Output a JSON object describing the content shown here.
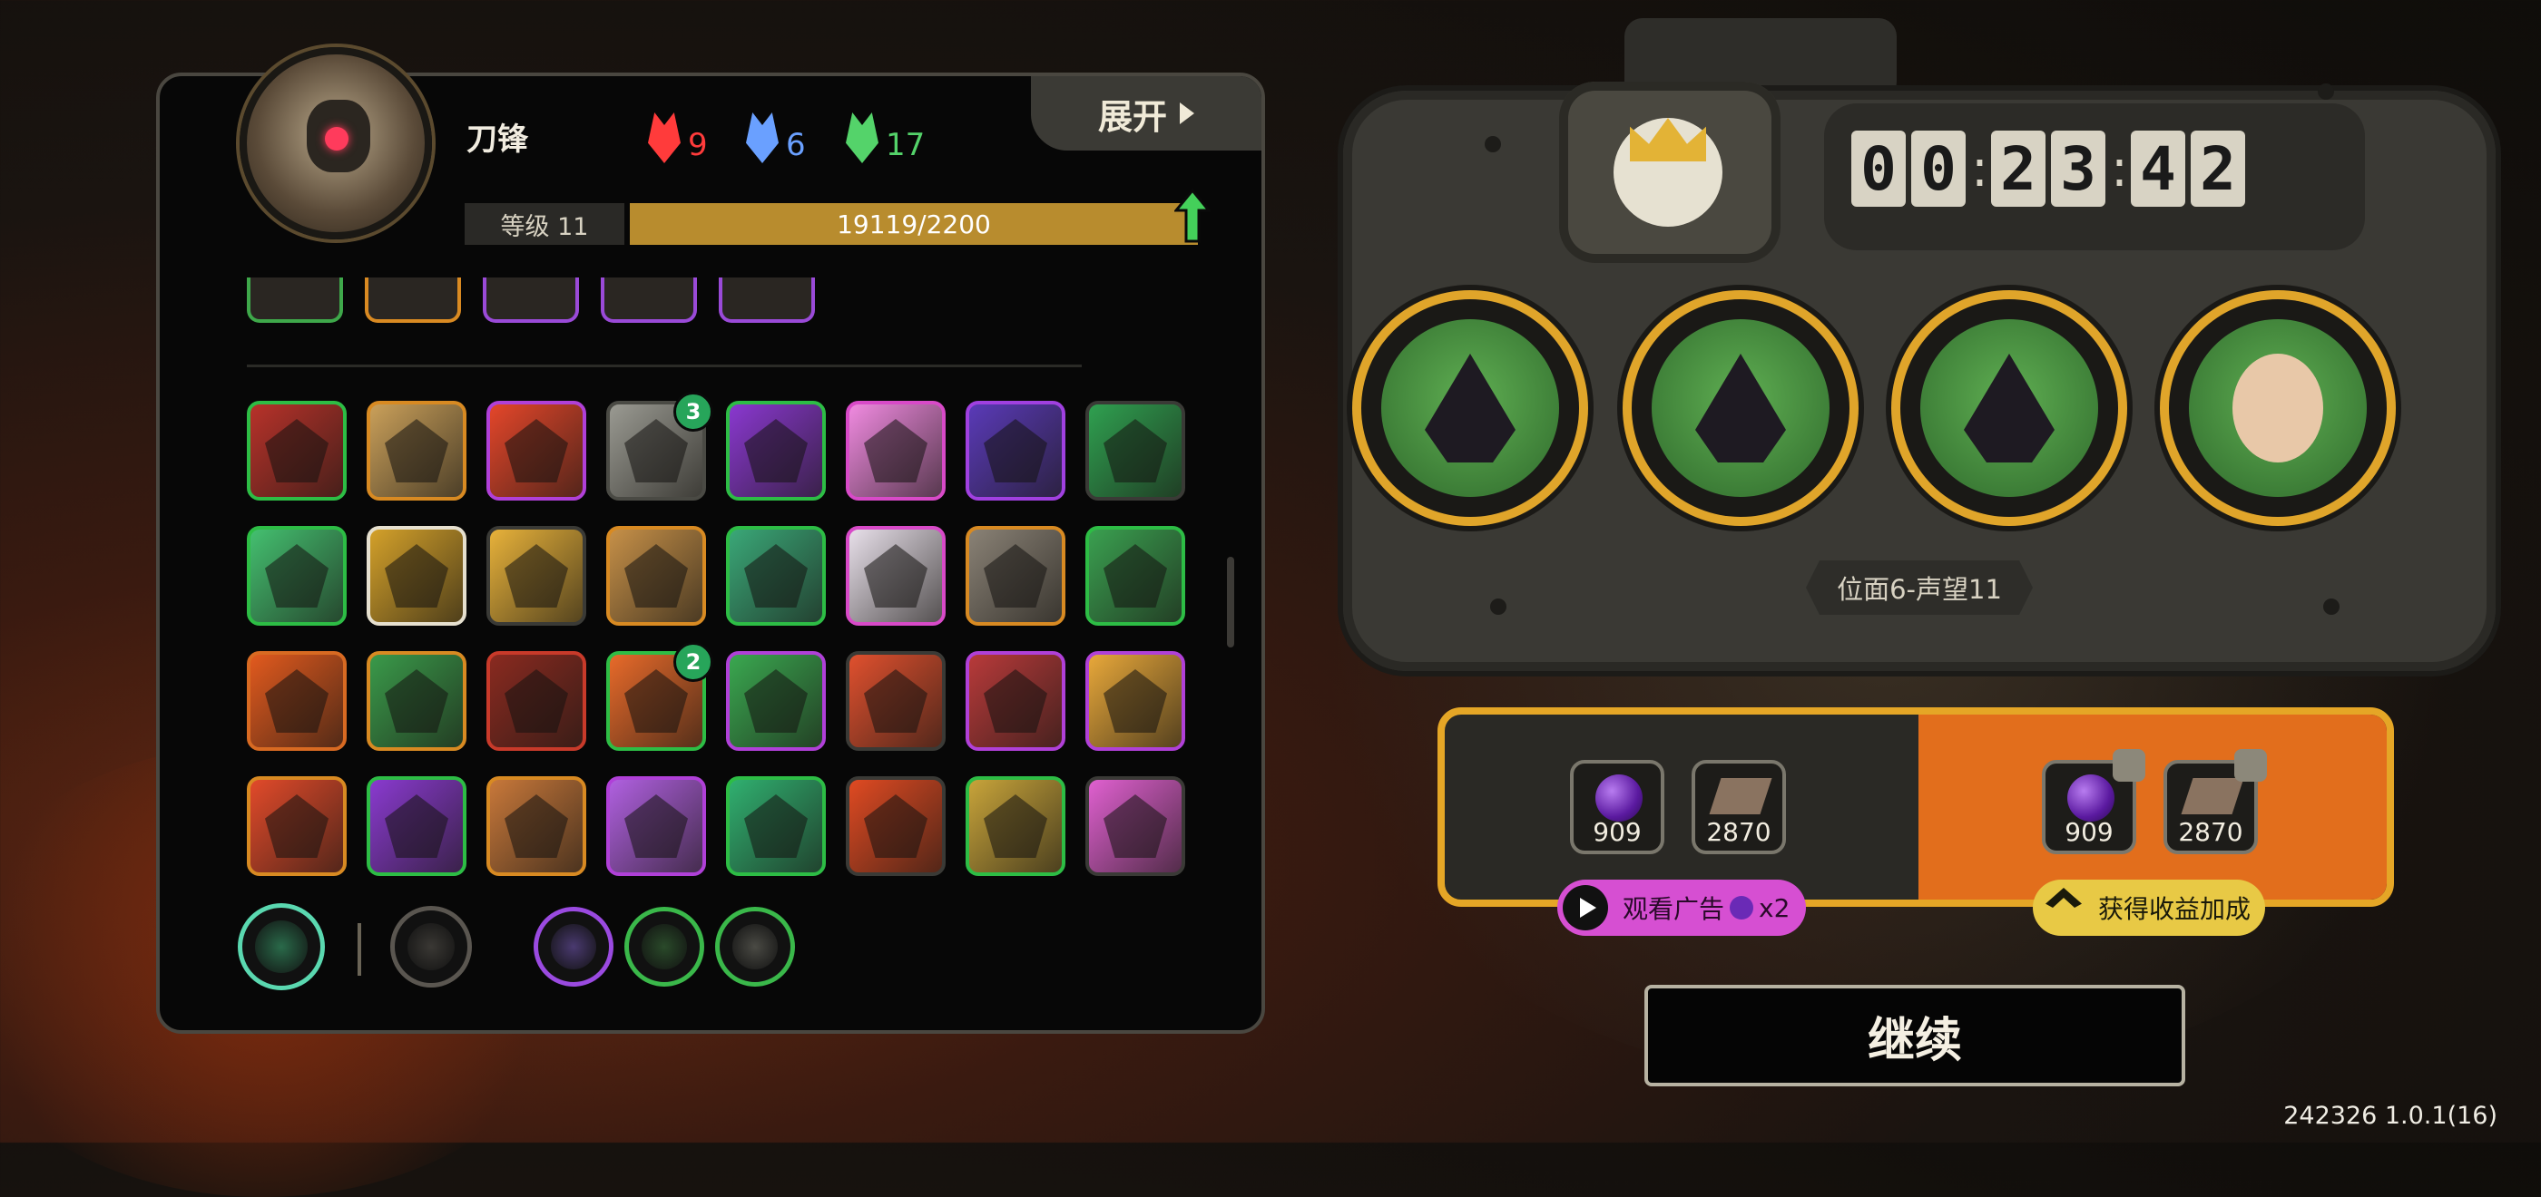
{
  "hero": {
    "name": "刀锋",
    "level_label": "等级 11",
    "xp_text": "19119/2200",
    "xp_fraction": 1.0
  },
  "resources": [
    {
      "icon": "red-mask-icon",
      "value": "9",
      "color": "#ff3b3b"
    },
    {
      "icon": "blue-mask-icon",
      "value": "6",
      "color": "#6aa0ff"
    },
    {
      "icon": "green-mask-icon",
      "value": "17",
      "color": "#54d36a"
    }
  ],
  "expand_button": {
    "label": "展开"
  },
  "partial_row": [
    {
      "icon": "partial-skill-icon",
      "color": "#3ea84a"
    },
    {
      "icon": "partial-skill-icon",
      "color": "#d98a22"
    },
    {
      "icon": "partial-skill-icon",
      "color": "#9a4ad8"
    },
    {
      "icon": "partial-skill-icon",
      "color": "#9a4ad8"
    },
    {
      "icon": "partial-skill-icon",
      "color": "#9a4ad8"
    }
  ],
  "skills": [
    {
      "icon": "dragon-head-icon",
      "border": "#2dbd45",
      "fill": "#b8322a",
      "badge": ""
    },
    {
      "icon": "gear-eye-icon",
      "border": "#d88a22",
      "fill": "#caa05a",
      "badge": ""
    },
    {
      "icon": "lightning-icon",
      "border": "#b040d8",
      "fill": "#e4462a",
      "badge": ""
    },
    {
      "icon": "armored-box-icon",
      "border": "#4a4a44",
      "fill": "#9a9a92",
      "badge": "3"
    },
    {
      "icon": "warning-triangle-icon",
      "border": "#2dbd45",
      "fill": "#8a38d0",
      "badge": ""
    },
    {
      "icon": "pink-burst-icon",
      "border": "#d84ac8",
      "fill": "#f08ae0",
      "badge": ""
    },
    {
      "icon": "crystal-icon",
      "border": "#a040e0",
      "fill": "#5a3ab8",
      "badge": ""
    },
    {
      "icon": "green-claws-icon",
      "border": "#3a3a36",
      "fill": "#2fa050",
      "badge": ""
    },
    {
      "icon": "green-diamond-icon",
      "border": "#2dbd45",
      "fill": "#44c070",
      "badge": ""
    },
    {
      "icon": "golden-helm-icon",
      "border": "#e6e0cf",
      "fill": "#d4a12a",
      "badge": ""
    },
    {
      "icon": "explosion-icon",
      "border": "#3a3a36",
      "fill": "#e8b23a",
      "badge": ""
    },
    {
      "icon": "spike-icon",
      "border": "#d88a22",
      "fill": "#c69048",
      "badge": ""
    },
    {
      "icon": "arrows-icon",
      "border": "#2dbd45",
      "fill": "#3aa878",
      "badge": ""
    },
    {
      "icon": "mask-face-icon",
      "border": "#d84ac8",
      "fill": "#e8e0ea",
      "badge": ""
    },
    {
      "icon": "round-shield-icon",
      "border": "#d88a22",
      "fill": "#8a8276",
      "badge": ""
    },
    {
      "icon": "red-cursor-icon",
      "border": "#2dbd45",
      "fill": "#3aa050",
      "badge": ""
    },
    {
      "icon": "flame-face-icon",
      "border": "#d86a22",
      "fill": "#e25a1e",
      "badge": ""
    },
    {
      "icon": "green-tooth-icon",
      "border": "#d88a22",
      "fill": "#3a9a4a",
      "badge": ""
    },
    {
      "icon": "red-rings-icon",
      "border": "#c83a2a",
      "fill": "#8a2a20",
      "badge": ""
    },
    {
      "icon": "wings-icon",
      "border": "#2dbd45",
      "fill": "#e86a2a",
      "badge": "2"
    },
    {
      "icon": "green-slash-icon",
      "border": "#b040d8",
      "fill": "#3aa850",
      "badge": ""
    },
    {
      "icon": "pointing-hand-icon",
      "border": "#3a3a36",
      "fill": "#e0502e",
      "badge": ""
    },
    {
      "icon": "red-pod-icon",
      "border": "#b040d8",
      "fill": "#b83a3a",
      "badge": ""
    },
    {
      "icon": "bell-icon",
      "border": "#b040d8",
      "fill": "#e8a83a",
      "badge": ""
    },
    {
      "icon": "red-flower-icon",
      "border": "#d88a22",
      "fill": "#e24a2a",
      "badge": ""
    },
    {
      "icon": "purple-claws-icon",
      "border": "#2dbd45",
      "fill": "#8a3ad0",
      "badge": ""
    },
    {
      "icon": "wood-slash-icon",
      "border": "#d88a22",
      "fill": "#c8783a",
      "badge": ""
    },
    {
      "icon": "purple-drip-icon",
      "border": "#b040d8",
      "fill": "#b060e0",
      "badge": ""
    },
    {
      "icon": "green-shards-icon",
      "border": "#2dbd45",
      "fill": "#30b070",
      "badge": ""
    },
    {
      "icon": "fire-icon",
      "border": "#3a3a36",
      "fill": "#e04a22",
      "badge": ""
    },
    {
      "icon": "coin-shield-icon",
      "border": "#2dbd45",
      "fill": "#c8a43a",
      "badge": ""
    },
    {
      "icon": "pink-flame-icon",
      "border": "#3a3a36",
      "fill": "#e060d0",
      "badge": ""
    }
  ],
  "equipped_main": [
    {
      "icon": "green-wind-icon",
      "ring": "#5ad8b0",
      "fill": "#2a6a4a"
    },
    {
      "icon": "feather-knife-icon",
      "ring": "#5a5650",
      "fill": "#3a3834"
    }
  ],
  "equipped_items": [
    {
      "icon": "gold-insignia-icon",
      "ring": "#9a4ae0",
      "fill": "#4a3a70"
    },
    {
      "icon": "green-flask-icon",
      "ring": "#3ab84a",
      "fill": "#2a4a2a"
    },
    {
      "icon": "silver-triangle-icon",
      "ring": "#3ab84a",
      "fill": "#4a4a44"
    }
  ],
  "timer": {
    "digits": [
      "0",
      "0",
      "2",
      "3",
      "4",
      "2"
    ]
  },
  "party": [
    {
      "icon": "hooded-figure-icon",
      "inner": "#2f6a2c"
    },
    {
      "icon": "fanged-beast-icon",
      "inner": "#2f6a2c"
    },
    {
      "icon": "robot-head-icon",
      "inner": "#2f6a2c"
    },
    {
      "icon": "curly-hair-man-icon",
      "inner": "#2f6a2c"
    }
  ],
  "plane_label": "位面6-声望11",
  "rewards": {
    "base": [
      {
        "icon": "purple-orb-icon",
        "value": "909"
      },
      {
        "icon": "book-icon",
        "value": "2870"
      }
    ],
    "boosted": [
      {
        "icon": "purple-orb-icon",
        "value": "909"
      },
      {
        "icon": "book-icon",
        "value": "2870"
      }
    ]
  },
  "ad_button": {
    "label": "观看广告",
    "multiplier": "x2"
  },
  "bonus_button": {
    "label": "获得收益加成"
  },
  "continue_button": {
    "label": "继续"
  },
  "version": "242326 1.0.1(16)",
  "colors": {
    "gold": "#e5a626",
    "orange": "#e26e1c",
    "xp": "#b88c2e"
  }
}
